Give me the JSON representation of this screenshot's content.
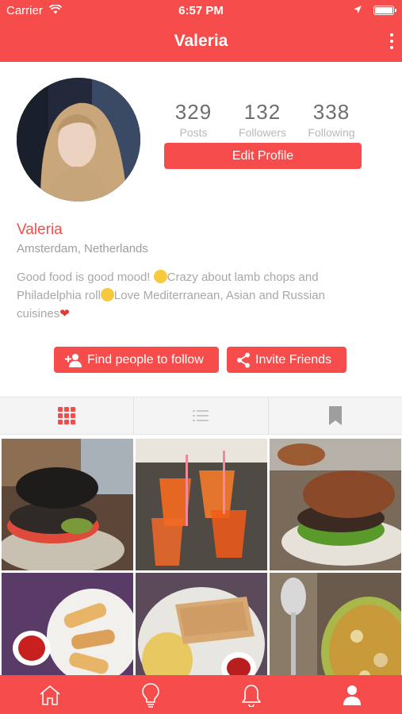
{
  "status_bar": {
    "carrier": "Carrier",
    "time": "6:57 PM"
  },
  "navbar": {
    "title": "Valeria"
  },
  "stats": [
    {
      "value": "329",
      "label": "Posts"
    },
    {
      "value": "132",
      "label": "Followers"
    },
    {
      "value": "338",
      "label": "Following"
    }
  ],
  "edit_profile_label": "Edit Profile",
  "profile": {
    "name": "Valeria",
    "location": "Amsterdam, Netherlands",
    "bio_1": "Good food is good mood! ",
    "bio_2": "Crazy about lamb chops and Philadelphia roll",
    "bio_3": "Love Mediterranean, Asian and Russian cuisines"
  },
  "actions": {
    "find": "Find people to follow",
    "invite": "Invite Friends"
  },
  "colors": {
    "accent": "#f64c4c",
    "muted": "#a8a8a8"
  },
  "icons": {
    "tabs": [
      "grid-icon",
      "list-icon",
      "bookmark-icon"
    ],
    "tabbar": [
      "home-icon",
      "lightbulb-icon",
      "bell-icon",
      "user-icon"
    ]
  }
}
